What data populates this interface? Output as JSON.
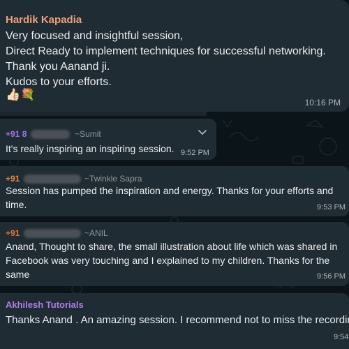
{
  "messages": [
    {
      "sender": "Hardik Kapadia",
      "text": "Very focused and insightful session,\nDirect Ready to implement techniques for successful networking.\nThank you Aanand ji.\nKudos to your efforts.",
      "emoji": "👍🏻💐",
      "time": "10:16 PM"
    },
    {
      "sender_prefix": "+91 8",
      "sender_name": "~Sumit",
      "text": "It's really inspiring an inspiring session.",
      "time": "9:52 PM",
      "menu_icon": "chevron-down-icon"
    },
    {
      "sender_prefix": "+91",
      "sender_name": "~Twinkle Sapra",
      "text": "Session has pumped the inspiration and energy. Thanks for your efforts and time.",
      "time": "9:53 PM"
    },
    {
      "sender_prefix": "+91",
      "sender_name": "~ANIL",
      "text": "Anand, Thought to share, the small illustration about life which was shared in Facebook was very touching and I explained to my children. Thanks for the same",
      "time": "9:56 PM"
    },
    {
      "sender": "Akhilesh Tutorials",
      "text": "Thanks Anand . An amazing session. I recommend not to miss the recording",
      "time": "9:54"
    }
  ],
  "colors": {
    "background": "#0b1419",
    "bubble": "#202c33",
    "text": "#e9edef",
    "time": "#aeb5b9"
  }
}
